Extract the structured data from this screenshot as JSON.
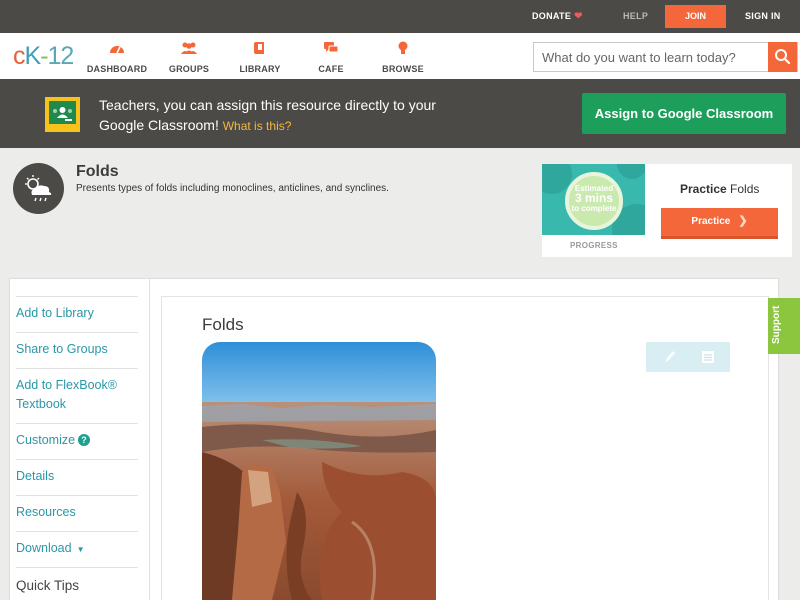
{
  "topbar": {
    "donate_label": "DONATE",
    "help_label": "HELP",
    "join_label": "JOIN",
    "signin_label": "SIGN IN"
  },
  "nav": {
    "logo": {
      "c": "c",
      "k": "K",
      "dash": "-",
      "n12": "12"
    },
    "items": [
      {
        "label": "DASHBOARD",
        "icon": "dashboard-gauge-icon"
      },
      {
        "label": "GROUPS",
        "icon": "groups-people-icon"
      },
      {
        "label": "LIBRARY",
        "icon": "library-book-icon"
      },
      {
        "label": "CAFE",
        "icon": "cafe-chat-icon"
      },
      {
        "label": "BROWSE",
        "icon": "browse-bulb-icon"
      }
    ],
    "search_placeholder": "What do you want to learn today?"
  },
  "banner": {
    "text": "Teachers, you can assign this resource directly to your Google Classroom!",
    "what_link": "What is this?",
    "assign_button": "Assign to Google Classroom"
  },
  "resource": {
    "title": "Folds",
    "description": "Presents types of folds including monoclines, anticlines, and synclines."
  },
  "practice": {
    "estimate_label": "Estimated",
    "estimate_value": "3 mins",
    "estimate_suffix": "to complete",
    "progress_label": "PROGRESS",
    "heading_bold": "Practice",
    "heading_rest": "Folds",
    "button_label": "Practice"
  },
  "sidebar": {
    "items": [
      {
        "label": "Add to Library"
      },
      {
        "label": "Share to Groups"
      },
      {
        "label": "Add to FlexBook® Textbook"
      },
      {
        "label": "Customize"
      },
      {
        "label": "Details"
      },
      {
        "label": "Resources"
      },
      {
        "label": "Download"
      }
    ],
    "quick_tips": "Quick Tips"
  },
  "main": {
    "title": "Folds"
  },
  "support_label": "Support",
  "colors": {
    "accent_orange": "#f4673a",
    "teal_link": "#2a97a8",
    "google_green": "#1e9e5b",
    "support_green": "#8cc63f",
    "dark_bar": "#4b4a47"
  }
}
